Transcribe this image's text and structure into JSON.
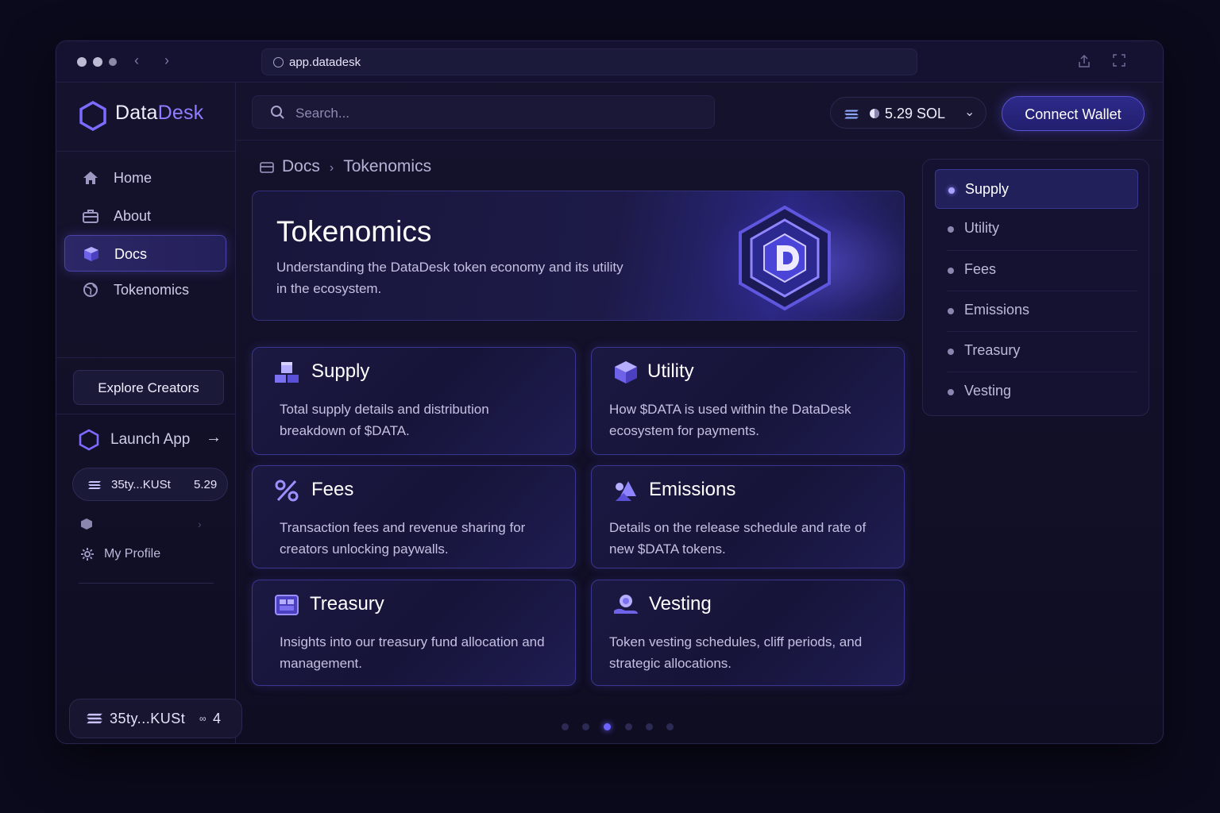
{
  "browser": {
    "url": "app.datadesk"
  },
  "brand": {
    "name_part1": "Data",
    "name_part2": "Desk"
  },
  "sidebar": {
    "items": [
      {
        "label": "Home",
        "icon": "home-icon"
      },
      {
        "label": "About",
        "icon": "briefcase-icon"
      },
      {
        "label": "Docs",
        "icon": "cube-icon",
        "active": true
      },
      {
        "label": "Tokenomics",
        "icon": "globe-icon"
      }
    ],
    "explore_label": "Explore Creators",
    "launch_label": "Launch App",
    "wallet_address": "35ty...KUSt",
    "wallet_balance": "5.29",
    "profile_label": "My Profile",
    "bottom_wallet_address": "35ty...KUSt",
    "bottom_wallet_count": "4"
  },
  "topbar": {
    "search_placeholder": "Search...",
    "sol_balance": "5.29 SOL",
    "connect_label": "Connect Wallet"
  },
  "breadcrumb": {
    "parent": "Docs",
    "current": "Tokenomics"
  },
  "hero": {
    "title": "Tokenomics",
    "subtitle": "Understanding the DataDesk token economy and its utility in the ecosystem."
  },
  "cards": [
    {
      "title": "Supply",
      "desc": "Total supply details and distribution breakdown of $DATA.",
      "icon": "coins-stack-icon"
    },
    {
      "title": "Utility",
      "desc": "How $DATA is used within the DataDesk ecosystem for payments.",
      "icon": "cube-icon"
    },
    {
      "title": "Fees",
      "desc": "Transaction fees and revenue sharing for creators unlocking paywalls.",
      "icon": "percent-icon"
    },
    {
      "title": "Emissions",
      "desc": "Details on the release schedule and rate of new $DATA tokens.",
      "icon": "shapes-icon"
    },
    {
      "title": "Treasury",
      "desc": "Insights into our treasury fund allocation and management.",
      "icon": "vault-icon"
    },
    {
      "title": "Vesting",
      "desc": "Token vesting schedules, cliff periods, and strategic allocations.",
      "icon": "hand-coin-icon"
    }
  ],
  "toc": {
    "items": [
      "Supply",
      "Utility",
      "Fees",
      "Emissions",
      "Treasury",
      "Vesting"
    ],
    "active_index": 0
  },
  "pager": {
    "count": 6,
    "active_index": 2
  },
  "colors": {
    "accent": "#6c63ff",
    "brand_blue": "#8f7dff",
    "background": "#0b0a1c"
  }
}
